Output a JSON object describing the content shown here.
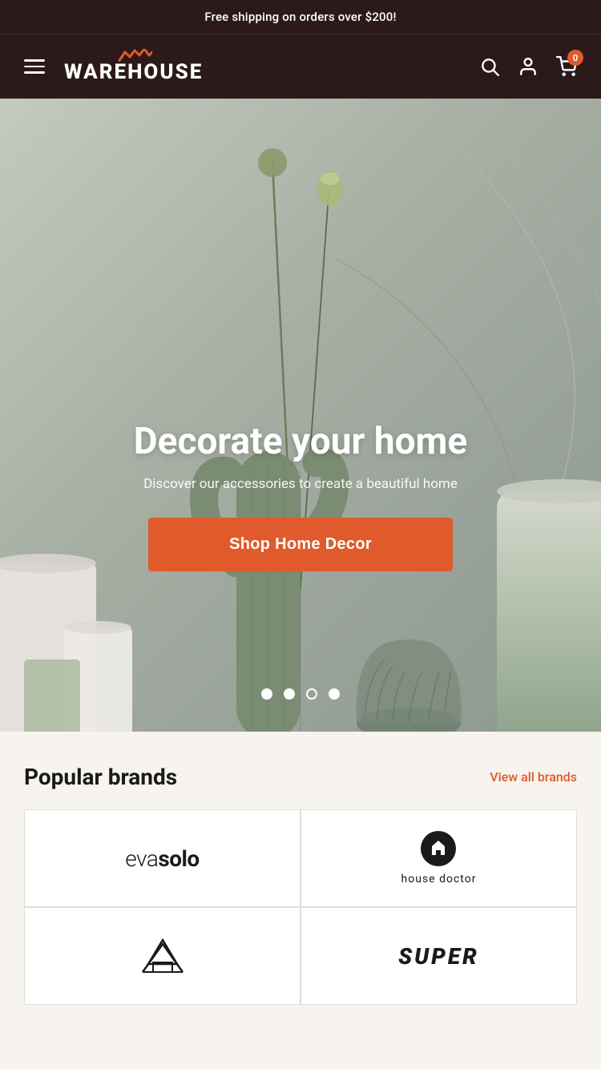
{
  "announcement": {
    "text": "Free shipping on orders over $200!"
  },
  "header": {
    "logo_text": "WAREHOUSE",
    "cart_count": "0",
    "hamburger_label": "Menu",
    "search_label": "Search",
    "account_label": "Account",
    "cart_label": "Cart"
  },
  "hero": {
    "title": "Decorate your home",
    "subtitle": "Discover our accessories to create a beautiful home",
    "cta_label": "Shop Home Decor",
    "dots": [
      {
        "active": true
      },
      {
        "active": true
      },
      {
        "active": false
      },
      {
        "active": true
      }
    ]
  },
  "brands": {
    "section_title": "Popular brands",
    "view_all_label": "View all brands",
    "items": [
      {
        "name": "evasolo",
        "display": "evasolo",
        "type": "text"
      },
      {
        "name": "house-doctor",
        "display": "house doctor",
        "type": "icon-text"
      },
      {
        "name": "brand3",
        "display": "",
        "type": "outline-mountain"
      },
      {
        "name": "super",
        "display": "SUPER",
        "type": "bold-italic"
      }
    ]
  }
}
